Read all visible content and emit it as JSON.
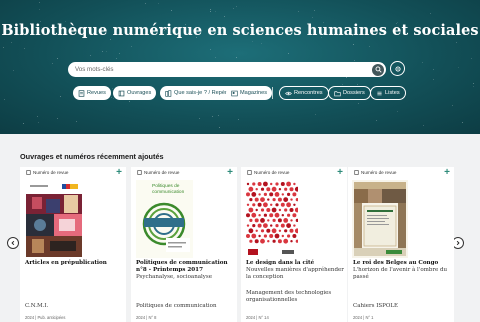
{
  "hero": {
    "title": "Bibliothèque numérique en sciences humaines et sociales",
    "search_placeholder": "Vos mots-clés",
    "chips": [
      {
        "label": "Revues",
        "icon": "journal-icon"
      },
      {
        "label": "Ouvrages",
        "icon": "book-icon"
      },
      {
        "label": "Que sais-je ? / Repères",
        "icon": "book-stack-icon"
      },
      {
        "label": "Magazines",
        "icon": "magazine-icon"
      },
      {
        "label": "Rencontres",
        "icon": "eye-icon"
      },
      {
        "label": "Dossiers",
        "icon": "folder-icon"
      },
      {
        "label": "Listes",
        "icon": "list-icon"
      }
    ]
  },
  "section": {
    "title": "Ouvrages et numéros récemment ajoutés",
    "cards": [
      {
        "type_label": "Numéro de revue",
        "title": "Articles en prépublication",
        "subtitle": "",
        "publication": "C.N.M.I.",
        "meta": "2024 | Pub. anticipées"
      },
      {
        "type_label": "Numéro de revue",
        "title": "Politiques de communication n°8 - Printemps 2017",
        "subtitle": "Psychanalyse, socioanalyse",
        "publication": "Politiques de communication",
        "meta": "2024 | N° 8",
        "cover_title": "Politiques de communication"
      },
      {
        "type_label": "Numéro de revue",
        "title": "Le design dans la cité",
        "subtitle": "Nouvelles manières d'appréhender la conception",
        "publication": "Management des technologies organisationnelles",
        "meta": "2024 | N° 14"
      },
      {
        "type_label": "Numéro de revue",
        "title": "Le roi des Belges au Congo",
        "subtitle": "L'horizon de l'avenir à l'ombre du passé",
        "publication": "Cahiers ISPOLE",
        "meta": "2024 | N° 1"
      }
    ]
  },
  "colors": {
    "hero_bg": "#124f57",
    "accent_plus": "#2e8b7a",
    "section_bg": "#f1f2f3"
  }
}
